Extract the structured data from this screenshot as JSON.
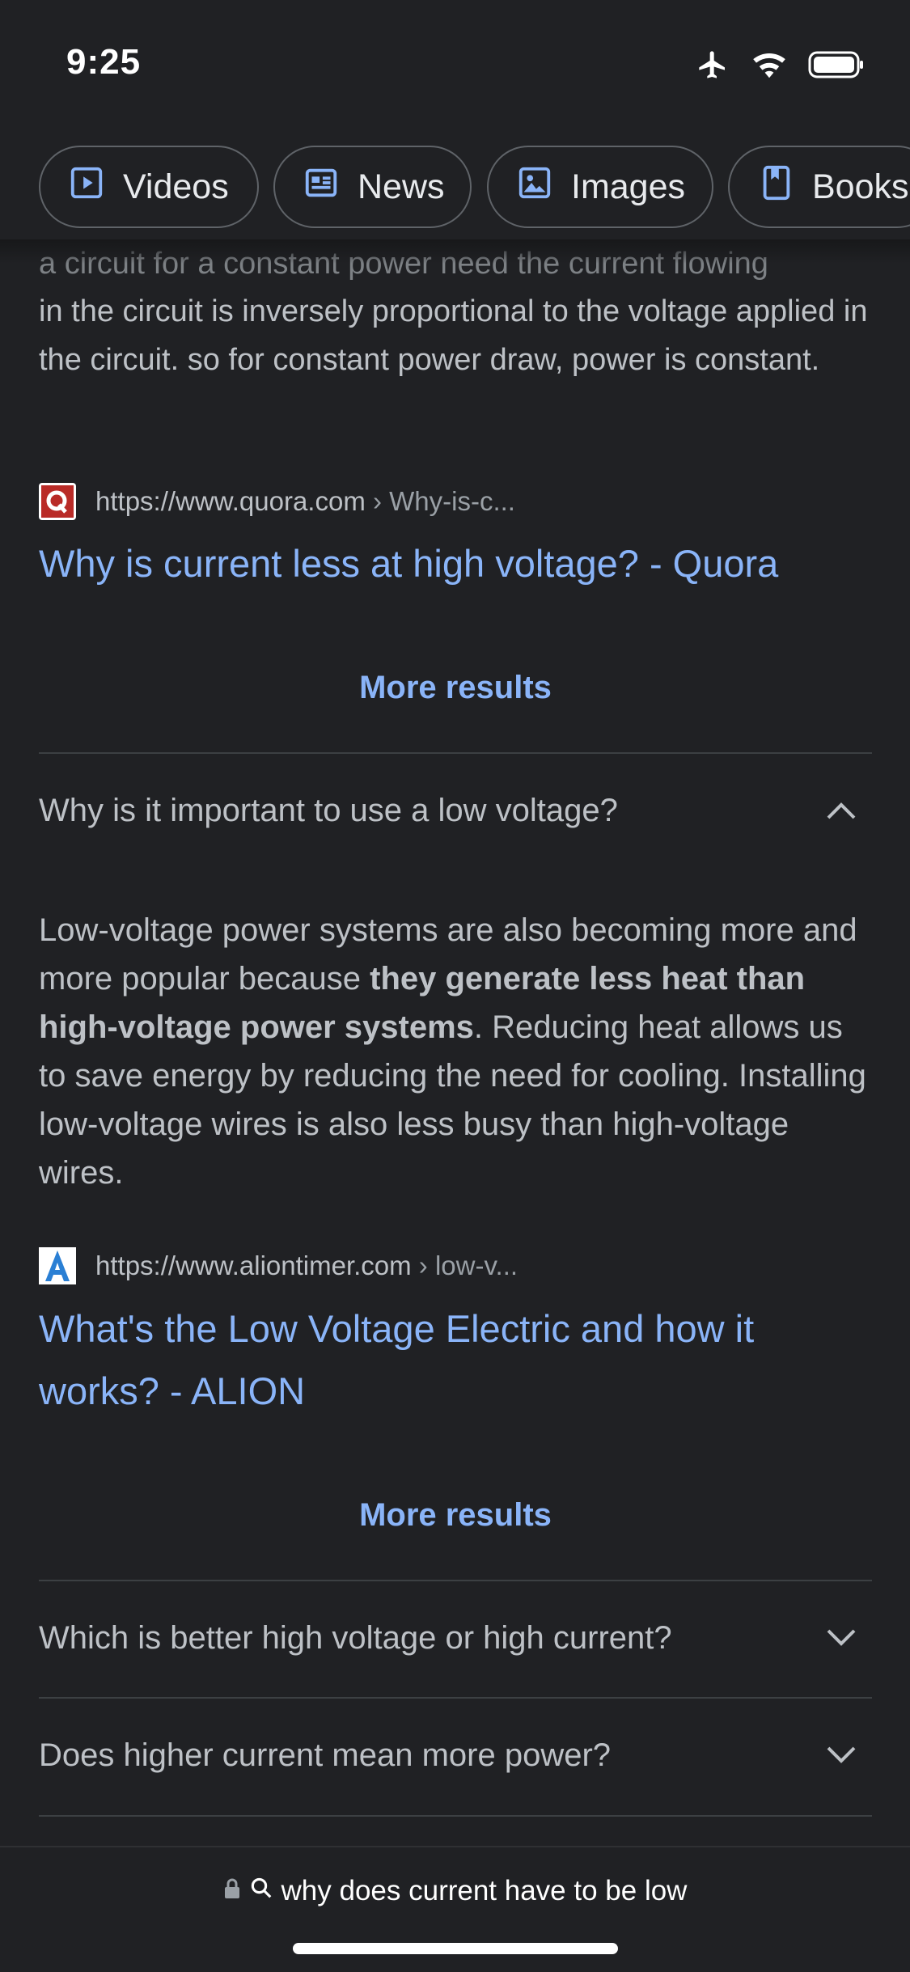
{
  "status_bar": {
    "time": "9:25"
  },
  "chips": [
    {
      "label": "Videos",
      "icon": "video-play-icon"
    },
    {
      "label": "News",
      "icon": "newspaper-icon"
    },
    {
      "label": "Images",
      "icon": "image-icon"
    },
    {
      "label": "Books",
      "icon": "book-icon"
    }
  ],
  "first_answer": {
    "partial_top": "a circuit for a constant power need the current flowing",
    "snippet": "in the circuit is inversely proportional to the voltage applied in the circuit. so for constant power draw, power is constant.",
    "source_url": "https://www.quora.com",
    "source_path": " › Why-is-c...",
    "title": "Why is current less at high voltage? - Quora",
    "more_results": "More results"
  },
  "expanded_question": {
    "question": "Why is it important to use a low voltage?",
    "answer_prefix": "Low-voltage power systems are also becoming more and more popular because ",
    "answer_bold": "they generate less heat than high-voltage power systems",
    "answer_suffix": ". Reducing heat allows us to save energy by reducing the need for cooling. Installing low-voltage wires is also less busy than high-voltage wires.",
    "source_url": "https://www.aliontimer.com",
    "source_path": " › low-v...",
    "title": "What's the Low Voltage Electric and how it works? - ALION",
    "more_results": "More results"
  },
  "collapsed_questions": [
    {
      "question": "Which is better high voltage or high current?"
    },
    {
      "question": "Does higher current mean more power?"
    }
  ],
  "bottom_bar": {
    "url_text": "why does current have to be low"
  },
  "colors": {
    "background": "#202124",
    "link": "#8ab4f8",
    "text": "#bdc1c6"
  }
}
